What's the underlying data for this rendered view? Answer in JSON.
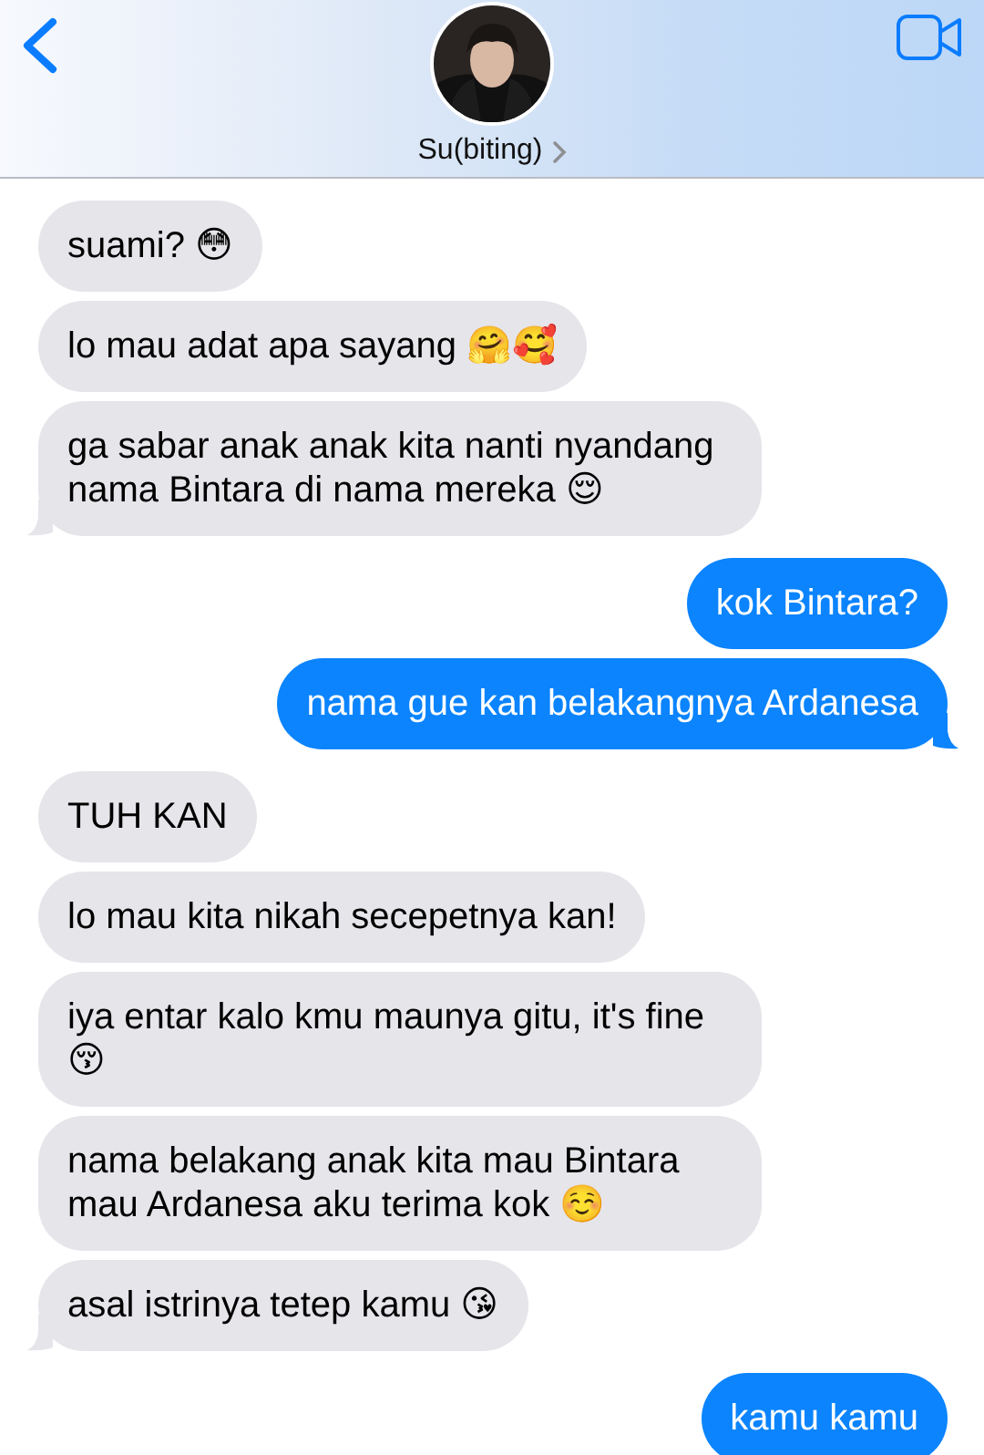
{
  "contact": {
    "name": "Su(biting)"
  },
  "messages": [
    {
      "kind": "received",
      "text": "suami? 😳",
      "tail": false
    },
    {
      "kind": "received",
      "text": "lo mau adat apa sayang 🤗🥰",
      "tail": false
    },
    {
      "kind": "received",
      "text": "ga sabar anak anak kita nanti nyandang nama Bintara di nama mereka 😌",
      "tail": true
    },
    {
      "kind": "sent",
      "text": "kok Bintara?",
      "tail": false
    },
    {
      "kind": "sent",
      "text": "nama gue kan belakangnya Ardanesa",
      "tail": true
    },
    {
      "kind": "received",
      "text": "TUH KAN",
      "tail": false
    },
    {
      "kind": "received",
      "text": "lo mau kita nikah secepetnya kan!",
      "tail": false
    },
    {
      "kind": "received",
      "text": "iya entar kalo kmu maunya gitu, it's fine 😚",
      "tail": false
    },
    {
      "kind": "received",
      "text": "nama belakang anak kita mau Bintara mau Ardanesa aku terima kok ☺️",
      "tail": false
    },
    {
      "kind": "received",
      "text": "asal istrinya tetep kamu 😘",
      "tail": true
    },
    {
      "kind": "sent",
      "text": "kamu kamu",
      "tail": false
    }
  ]
}
